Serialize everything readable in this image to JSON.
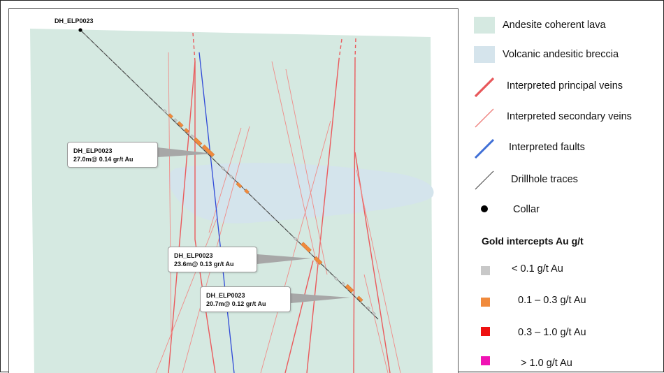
{
  "drillhole": {
    "collar_label": "DH_ELP0023",
    "intercepts": [
      {
        "hole": "DH_ELP0023",
        "interval": "27.0m@ 0.14 gr/t Au"
      },
      {
        "hole": "DH_ELP0023",
        "interval": "23.6m@ 0.13 gr/t Au"
      },
      {
        "hole": "DH_ELP0023",
        "interval": "20.7m@ 0.12 gr/t Au"
      }
    ]
  },
  "legend": {
    "items": [
      {
        "label": "Andesite coherent lava",
        "icon": "andesite-lava-swatch",
        "color": "#d5e9e1"
      },
      {
        "label": "Volcanic andesitic breccia",
        "icon": "volcanic-breccia-swatch",
        "color": "#d5e4ec"
      },
      {
        "label": "Interpreted principal veins",
        "icon": "principal-vein-line",
        "color": "#e8575a"
      },
      {
        "label": "Interpreted secondary veins",
        "icon": "secondary-vein-line",
        "color": "#ee7f7c"
      },
      {
        "label": "Interpreted faults",
        "icon": "fault-line",
        "color": "#3f6fd6"
      },
      {
        "label": "Drillhole traces",
        "icon": "drillhole-trace-line",
        "color": "#333333"
      },
      {
        "label": "Collar",
        "icon": "collar-dot",
        "color": "#000000"
      }
    ],
    "gold_heading": "Gold intercepts Au g/t",
    "gold_items": [
      {
        "label": "< 0.1 g/t Au",
        "color": "#c8c8c8"
      },
      {
        "label": "0.1 – 0.3 g/t Au",
        "color": "#f08a3c"
      },
      {
        "label": "0.3 – 1.0 g/t Au",
        "color": "#ee1111"
      },
      {
        "label": "> 1.0 g/t Au",
        "color": "#f013b4"
      }
    ]
  }
}
